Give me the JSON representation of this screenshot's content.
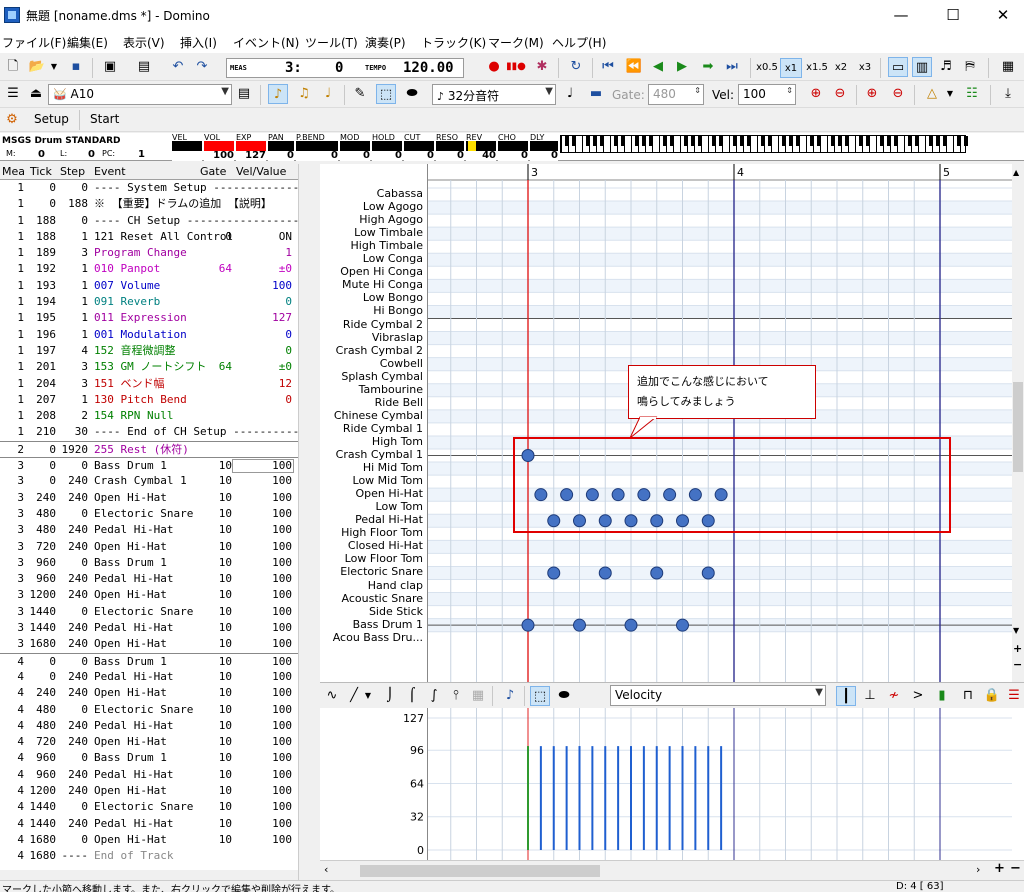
{
  "window": {
    "title": "無題 [noname.dms *] - Domino",
    "min": "—",
    "max": "☐",
    "close": "✕"
  },
  "menu": [
    "ファイル(F)",
    "編集(E)",
    "表示(V)",
    "挿入(I)",
    "イベント(N)",
    "ツール(T)",
    "演奏(P)",
    "トラック(K)",
    "マーク(M)",
    "ヘルプ(H)"
  ],
  "transport": {
    "meas_label": "MEAS",
    "meas_value": "3:",
    "tick_value": "0",
    "tempo_label": "TEMPO",
    "tempo_value": "120.00",
    "speeds": [
      "x0.5",
      "x1",
      "x1.5",
      "x2",
      "x3"
    ]
  },
  "toolbar2": {
    "instrument": "A10",
    "note_length": "32分音符",
    "gate_label": "Gate:",
    "gate_value": "480",
    "vel_label": "Vel:",
    "vel_value": "100"
  },
  "setup_bar": {
    "setup": "Setup",
    "start": "Start"
  },
  "meters": {
    "drum_set": "MSGS Drum STANDARD",
    "m_label": "M:",
    "m_value": "0",
    "l_label": "L:",
    "l_value": "0",
    "pc_label": "PC:",
    "pc_value": "1",
    "labels": [
      "VEL",
      "VOL",
      "EXP",
      "PAN",
      "P.BEND",
      "MOD",
      "HOLD",
      "CUT",
      "RESO",
      "REV",
      "CHO",
      "DLY"
    ],
    "values": [
      "",
      "100",
      "127",
      "0",
      "0",
      "0",
      "0",
      "0",
      "0",
      "40",
      "0",
      "0"
    ]
  },
  "event_list": {
    "headers": [
      "Mea",
      "Tick",
      "Step",
      "Event",
      "Gate",
      "Vel/Value"
    ],
    "rows": [
      {
        "mea": "1",
        "tick": "0",
        "step": "0",
        "event": "---- System Setup --------------",
        "gate": "",
        "val": "",
        "color": "#000"
      },
      {
        "mea": "1",
        "tick": "0",
        "step": "188",
        "event": "※ 【重要】ドラムの追加 【説明】",
        "gate": "",
        "val": "",
        "color": "#000"
      },
      {
        "mea": "1",
        "tick": "188",
        "step": "0",
        "event": "---- CH Setup ------------------",
        "gate": "",
        "val": "",
        "color": "#000"
      },
      {
        "mea": "1",
        "tick": "188",
        "step": "1",
        "event": "121 Reset All Control",
        "gate": "0",
        "val": "ON",
        "color": "#000"
      },
      {
        "mea": "1",
        "tick": "189",
        "step": "3",
        "event": "Program Change",
        "gate": "",
        "val": "1",
        "color": "#a000a0"
      },
      {
        "mea": "1",
        "tick": "192",
        "step": "1",
        "event": "010 Panpot",
        "gate": "64",
        "val": "±0",
        "color": "#c000c0"
      },
      {
        "mea": "1",
        "tick": "193",
        "step": "1",
        "event": "007 Volume",
        "gate": "",
        "val": "100",
        "color": "#0000c8"
      },
      {
        "mea": "1",
        "tick": "194",
        "step": "1",
        "event": "091 Reverb",
        "gate": "",
        "val": "0",
        "color": "#008080"
      },
      {
        "mea": "1",
        "tick": "195",
        "step": "1",
        "event": "011 Expression",
        "gate": "",
        "val": "127",
        "color": "#a000a0"
      },
      {
        "mea": "1",
        "tick": "196",
        "step": "1",
        "event": "001 Modulation",
        "gate": "",
        "val": "0",
        "color": "#0000c8"
      },
      {
        "mea": "1",
        "tick": "197",
        "step": "4",
        "event": "152 音程微調整",
        "gate": "",
        "val": "0",
        "color": "#008000"
      },
      {
        "mea": "1",
        "tick": "201",
        "step": "3",
        "event": "153 GM ノートシフト",
        "gate": "64",
        "val": "±0",
        "color": "#008000"
      },
      {
        "mea": "1",
        "tick": "204",
        "step": "3",
        "event": "151 ベンド幅",
        "gate": "",
        "val": "12",
        "color": "#c00000"
      },
      {
        "mea": "1",
        "tick": "207",
        "step": "1",
        "event": "130 Pitch Bend",
        "gate": "",
        "val": "0",
        "color": "#c00000"
      },
      {
        "mea": "1",
        "tick": "208",
        "step": "2",
        "event": "154 RPN Null",
        "gate": "",
        "val": "",
        "color": "#008000"
      },
      {
        "mea": "1",
        "tick": "210",
        "step": "30",
        "event": "---- End of CH Setup ----------",
        "gate": "",
        "val": "",
        "color": "#000"
      },
      {
        "mea": "2",
        "tick": "0",
        "step": "1920",
        "event": "255 Rest (休符)",
        "gate": "",
        "val": "",
        "color": "#a000a0",
        "sep": true
      },
      {
        "mea": "3",
        "tick": "0",
        "step": "0",
        "event": "Bass Drum 1",
        "gate": "10",
        "val": "100",
        "color": "#000",
        "sep": true
      },
      {
        "mea": "3",
        "tick": "0",
        "step": "240",
        "event": "Crash Cymbal 1",
        "gate": "10",
        "val": "100",
        "color": "#000"
      },
      {
        "mea": "3",
        "tick": "240",
        "step": "240",
        "event": "Open Hi-Hat",
        "gate": "10",
        "val": "100",
        "color": "#000"
      },
      {
        "mea": "3",
        "tick": "480",
        "step": "0",
        "event": "Electoric Snare",
        "gate": "10",
        "val": "100",
        "color": "#000"
      },
      {
        "mea": "3",
        "tick": "480",
        "step": "240",
        "event": "Pedal Hi-Hat",
        "gate": "10",
        "val": "100",
        "color": "#000"
      },
      {
        "mea": "3",
        "tick": "720",
        "step": "240",
        "event": "Open Hi-Hat",
        "gate": "10",
        "val": "100",
        "color": "#000"
      },
      {
        "mea": "3",
        "tick": "960",
        "step": "0",
        "event": "Bass Drum 1",
        "gate": "10",
        "val": "100",
        "color": "#000"
      },
      {
        "mea": "3",
        "tick": "960",
        "step": "240",
        "event": "Pedal Hi-Hat",
        "gate": "10",
        "val": "100",
        "color": "#000"
      },
      {
        "mea": "3",
        "tick": "1200",
        "step": "240",
        "event": "Open Hi-Hat",
        "gate": "10",
        "val": "100",
        "color": "#000"
      },
      {
        "mea": "3",
        "tick": "1440",
        "step": "0",
        "event": "Electoric Snare",
        "gate": "10",
        "val": "100",
        "color": "#000"
      },
      {
        "mea": "3",
        "tick": "1440",
        "step": "240",
        "event": "Pedal Hi-Hat",
        "gate": "10",
        "val": "100",
        "color": "#000"
      },
      {
        "mea": "3",
        "tick": "1680",
        "step": "240",
        "event": "Open Hi-Hat",
        "gate": "10",
        "val": "100",
        "color": "#000"
      },
      {
        "mea": "4",
        "tick": "0",
        "step": "0",
        "event": "Bass Drum 1",
        "gate": "10",
        "val": "100",
        "color": "#000",
        "sep": true
      },
      {
        "mea": "4",
        "tick": "0",
        "step": "240",
        "event": "Pedal Hi-Hat",
        "gate": "10",
        "val": "100",
        "color": "#000"
      },
      {
        "mea": "4",
        "tick": "240",
        "step": "240",
        "event": "Open Hi-Hat",
        "gate": "10",
        "val": "100",
        "color": "#000"
      },
      {
        "mea": "4",
        "tick": "480",
        "step": "0",
        "event": "Electoric Snare",
        "gate": "10",
        "val": "100",
        "color": "#000"
      },
      {
        "mea": "4",
        "tick": "480",
        "step": "240",
        "event": "Pedal Hi-Hat",
        "gate": "10",
        "val": "100",
        "color": "#000"
      },
      {
        "mea": "4",
        "tick": "720",
        "step": "240",
        "event": "Open Hi-Hat",
        "gate": "10",
        "val": "100",
        "color": "#000"
      },
      {
        "mea": "4",
        "tick": "960",
        "step": "0",
        "event": "Bass Drum 1",
        "gate": "10",
        "val": "100",
        "color": "#000"
      },
      {
        "mea": "4",
        "tick": "960",
        "step": "240",
        "event": "Pedal Hi-Hat",
        "gate": "10",
        "val": "100",
        "color": "#000"
      },
      {
        "mea": "4",
        "tick": "1200",
        "step": "240",
        "event": "Open Hi-Hat",
        "gate": "10",
        "val": "100",
        "color": "#000"
      },
      {
        "mea": "4",
        "tick": "1440",
        "step": "0",
        "event": "Electoric Snare",
        "gate": "10",
        "val": "100",
        "color": "#000"
      },
      {
        "mea": "4",
        "tick": "1440",
        "step": "240",
        "event": "Pedal Hi-Hat",
        "gate": "10",
        "val": "100",
        "color": "#000"
      },
      {
        "mea": "4",
        "tick": "1680",
        "step": "0",
        "event": "Open Hi-Hat",
        "gate": "10",
        "val": "100",
        "color": "#000"
      },
      {
        "mea": "4",
        "tick": "1680",
        "step": "----",
        "event": "End of Track",
        "gate": "",
        "val": "",
        "color": "#888"
      }
    ]
  },
  "piano_roll": {
    "measures": [
      "3",
      "4",
      "5"
    ],
    "note_names": [
      "Cabassa",
      "Low Agogo",
      "High Agogo",
      "Low Timbale",
      "High Timbale",
      "Low Conga",
      "Open Hi Conga",
      "Mute Hi Conga",
      "Low Bongo",
      "Hi Bongo",
      "Ride Cymbal 2",
      "Vibraslap",
      "Crash Cymbal 2",
      "Cowbell",
      "Splash Cymbal",
      "Tambourine",
      "Ride Bell",
      "Chinese Cymbal",
      "Ride Cymbal 1",
      "High Tom",
      "Crash Cymbal 1",
      "Hi Mid Tom",
      "Low Mid Tom",
      "Open Hi-Hat",
      "Low Tom",
      "Pedal Hi-Hat",
      "High Floor Tom",
      "Closed Hi-Hat",
      "Low Floor Tom",
      "Electoric Snare",
      "Hand clap",
      "Acoustic Snare",
      "Side Stick",
      "Bass Drum 1",
      "Acou Bass Dru..."
    ],
    "notes": [
      {
        "row": "Crash Cymbal 1",
        "beat": 0
      },
      {
        "row": "Open Hi-Hat",
        "beat": 0.5
      },
      {
        "row": "Open Hi-Hat",
        "beat": 1.5
      },
      {
        "row": "Open Hi-Hat",
        "beat": 2.5
      },
      {
        "row": "Open Hi-Hat",
        "beat": 3.5
      },
      {
        "row": "Open Hi-Hat",
        "beat": 4.5
      },
      {
        "row": "Open Hi-Hat",
        "beat": 5.5
      },
      {
        "row": "Open Hi-Hat",
        "beat": 6.5
      },
      {
        "row": "Open Hi-Hat",
        "beat": 7.5
      },
      {
        "row": "Pedal Hi-Hat",
        "beat": 1
      },
      {
        "row": "Pedal Hi-Hat",
        "beat": 2
      },
      {
        "row": "Pedal Hi-Hat",
        "beat": 3
      },
      {
        "row": "Pedal Hi-Hat",
        "beat": 4
      },
      {
        "row": "Pedal Hi-Hat",
        "beat": 5
      },
      {
        "row": "Pedal Hi-Hat",
        "beat": 6
      },
      {
        "row": "Pedal Hi-Hat",
        "beat": 7
      },
      {
        "row": "Electoric Snare",
        "beat": 1
      },
      {
        "row": "Electoric Snare",
        "beat": 3
      },
      {
        "row": "Electoric Snare",
        "beat": 5
      },
      {
        "row": "Electoric Snare",
        "beat": 7
      },
      {
        "row": "Bass Drum 1",
        "beat": 0
      },
      {
        "row": "Bass Drum 1",
        "beat": 2
      },
      {
        "row": "Bass Drum 1",
        "beat": 4
      },
      {
        "row": "Bass Drum 1",
        "beat": 6
      }
    ],
    "callout_line1": "追加でこんな感じにおいて",
    "callout_line2": "鳴らしてみましょう",
    "accent": "#4472c4"
  },
  "velocity": {
    "mode": "Velocity",
    "ticks": [
      "127",
      "96",
      "64",
      "32",
      "0"
    ],
    "bar_beats": [
      0.5,
      1,
      1.5,
      2,
      2.5,
      3,
      3.5,
      4,
      4.5,
      5,
      5.5,
      6,
      6.5,
      7,
      7.5
    ],
    "bar_value": 100
  },
  "statusbar": {
    "text": "マークした小節へ移動します。また、右クリックで編集や削除が行えます。",
    "right": "D: 4 [ 63]"
  }
}
